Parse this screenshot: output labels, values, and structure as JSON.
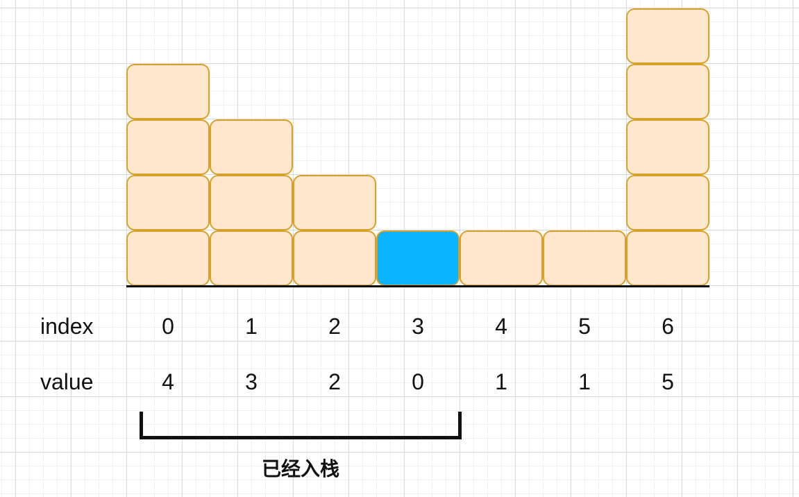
{
  "diagram": {
    "row_labels": {
      "index": "index",
      "value": "value"
    },
    "indices": [
      "0",
      "1",
      "2",
      "3",
      "4",
      "5",
      "6"
    ],
    "values": [
      "4",
      "3",
      "2",
      "0",
      "1",
      "1",
      "5"
    ],
    "bar_heights": [
      4,
      3,
      2,
      1,
      1,
      1,
      5
    ],
    "highlight_index": 3,
    "bracket_label": "已经入栈",
    "colors": {
      "block_fill": "#ffe6cc",
      "block_border": "#d6a12a",
      "highlight_fill": "#0bb4ff",
      "text": "#111111"
    }
  }
}
